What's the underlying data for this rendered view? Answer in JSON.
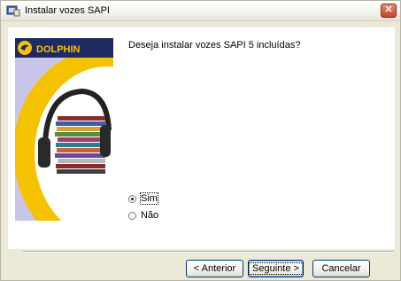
{
  "window": {
    "title": "Instalar vozes SAPI",
    "close_icon": "close-icon",
    "app_icon": "installer-icon"
  },
  "banner": {
    "logo_text": "DOLPHIN",
    "image": "headphones-with-cds-illustration",
    "colors": {
      "navy": "#1f2a63",
      "yellow": "#f5c200",
      "lavender": "#c9c6ea"
    }
  },
  "main": {
    "question": "Deseja instalar vozes SAPI 5 incluídas?",
    "options": [
      {
        "label": "Sim",
        "selected": true
      },
      {
        "label": "Não",
        "selected": false
      }
    ]
  },
  "buttons": {
    "back": "< Anterior",
    "next": "Seguinte >",
    "cancel": "Cancelar"
  }
}
